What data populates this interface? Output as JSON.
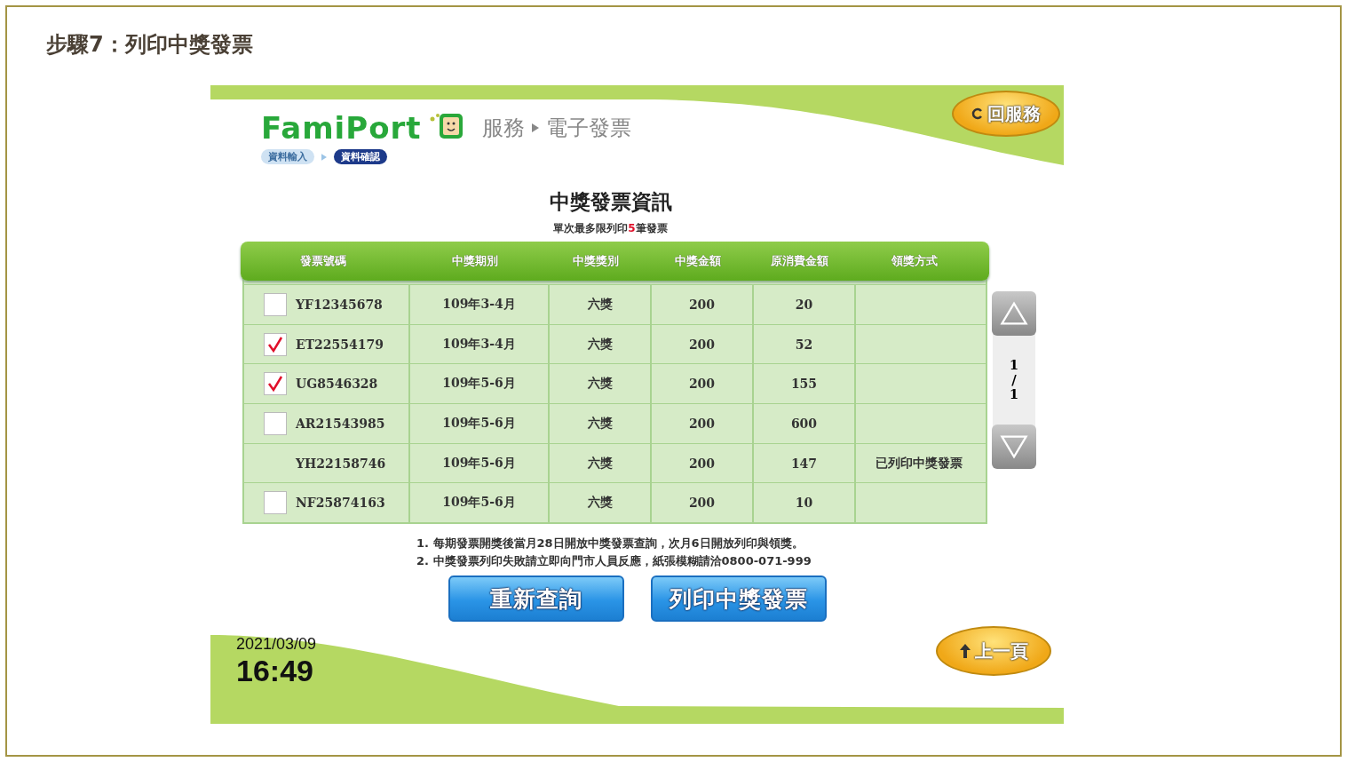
{
  "page_title": "步驟7：列印中獎發票",
  "kiosk": {
    "logo": "FamiPort",
    "breadcrumb": [
      "服務",
      "電子發票"
    ],
    "home_button": "回服務",
    "steps": [
      {
        "label": "資料輸入",
        "selected": false
      },
      {
        "label": "資料確認",
        "selected": true
      }
    ],
    "title": "中獎發票資訊",
    "subtitle": [
      {
        "text": "單次最多限列印",
        "highlight": false
      },
      {
        "text": "5",
        "highlight": true
      },
      {
        "text": "筆發票",
        "highlight": false
      }
    ],
    "table": {
      "columns": [
        "發票號碼",
        "中獎期別",
        "中獎獎別",
        "中獎金額",
        "原消費金額",
        "領獎方式"
      ],
      "rows": [
        {
          "kind": "selectable",
          "checked": false,
          "cells": [
            "YF12345678",
            "109年3-4月",
            "六獎",
            "200",
            "20",
            ""
          ]
        },
        {
          "kind": "selectable",
          "checked": true,
          "cells": [
            "ET22554179",
            "109年3-4月",
            "六獎",
            "200",
            "52",
            ""
          ]
        },
        {
          "kind": "selectable",
          "checked": true,
          "cells": [
            "UG8546328",
            "109年5-6月",
            "六獎",
            "200",
            "155",
            ""
          ]
        },
        {
          "kind": "selectable",
          "checked": false,
          "cells": [
            "AR21543985",
            "109年5-6月",
            "六獎",
            "200",
            "600",
            ""
          ]
        },
        {
          "kind": "printed",
          "checked": false,
          "cells": [
            "YH22158746",
            "109年5-6月",
            "六獎",
            "200",
            "147",
            "已列印中獎發票"
          ]
        },
        {
          "kind": "selectable",
          "checked": false,
          "cells": [
            "NF25874163",
            "109年5-6月",
            "六獎",
            "200",
            "10",
            ""
          ]
        }
      ]
    },
    "pager": [
      "1",
      "/",
      "1"
    ],
    "notes": [
      "1. 每期發票開獎後當月28日開放中獎發票查詢，次月6日開放列印與領獎。",
      "2. 中獎發票列印失敗請立即向門市人員反應，紙張模糊請洽0800-071-999"
    ],
    "buttons": [
      "重新查詢",
      "列印中獎發票"
    ],
    "date": "2021/03/09",
    "time": "16:49",
    "back_button": "上一頁"
  }
}
